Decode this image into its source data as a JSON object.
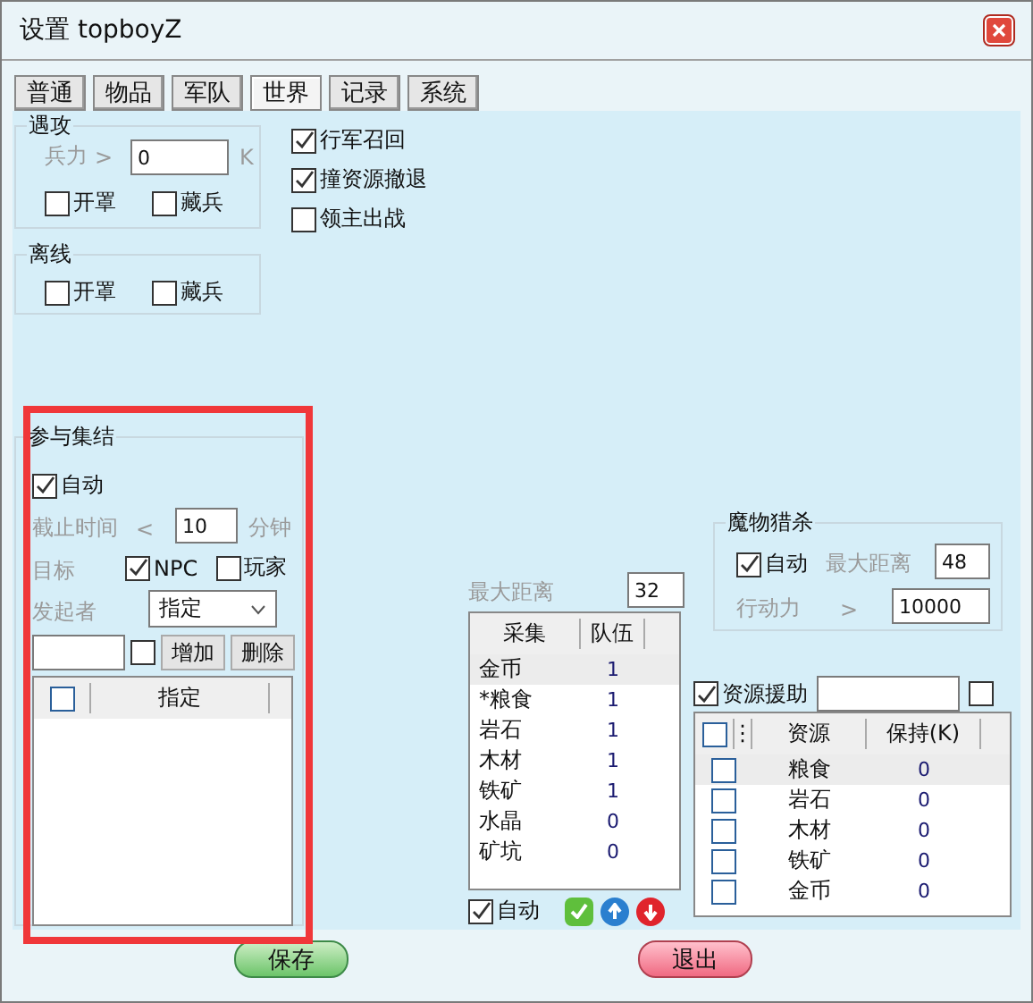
{
  "window": {
    "title": "设置 topboyZ"
  },
  "tabs": [
    {
      "label": "普通",
      "selected": false
    },
    {
      "label": "物品",
      "selected": false
    },
    {
      "label": "军队",
      "selected": false
    },
    {
      "label": "世界",
      "selected": true
    },
    {
      "label": "记录",
      "selected": false
    },
    {
      "label": "系统",
      "selected": false
    }
  ],
  "encounter": {
    "title": "遇攻",
    "strength_label": "兵力",
    "strength_op": ">",
    "strength_value": "0",
    "strength_unit": "K",
    "options": [
      {
        "label": "开罩",
        "checked": false
      },
      {
        "label": "藏兵",
        "checked": false
      }
    ]
  },
  "offline": {
    "title": "离线",
    "options": [
      {
        "label": "开罩",
        "checked": false
      },
      {
        "label": "藏兵",
        "checked": false
      }
    ]
  },
  "march_options": [
    {
      "label": "行军召回",
      "checked": true
    },
    {
      "label": "撞资源撤退",
      "checked": true
    },
    {
      "label": "领主出战",
      "checked": false
    }
  ],
  "rally": {
    "title": "参与集结",
    "auto": {
      "label": "自动",
      "checked": true
    },
    "deadline_label": "截止时间",
    "deadline_op": "<",
    "deadline_value": "10",
    "deadline_unit": "分钟",
    "target_label": "目标",
    "targets": [
      {
        "label": "NPC",
        "checked": true
      },
      {
        "label": "玩家",
        "checked": false
      }
    ],
    "initiator_label": "发起者",
    "initiator_value": "指定",
    "name_checked": false,
    "add_button": "增加",
    "delete_button": "删除",
    "table": {
      "header_checked": false,
      "column": "指定"
    }
  },
  "gather": {
    "distance_label": "最大距离",
    "distance_value": "32",
    "columns": [
      "采集",
      "队伍"
    ],
    "rows": [
      {
        "name": "金币",
        "count": "1",
        "selected": true
      },
      {
        "name": "*粮食",
        "count": "1",
        "selected": false
      },
      {
        "name": "岩石",
        "count": "1",
        "selected": false
      },
      {
        "name": "木材",
        "count": "1",
        "selected": false
      },
      {
        "name": "铁矿",
        "count": "1",
        "selected": false
      },
      {
        "name": "水晶",
        "count": "0",
        "selected": false
      },
      {
        "name": "矿坑",
        "count": "0",
        "selected": false
      }
    ],
    "auto": {
      "label": "自动",
      "checked": true
    }
  },
  "monster": {
    "title": "魔物猎杀",
    "auto": {
      "label": "自动",
      "checked": true
    },
    "distance_label": "最大距离",
    "distance_value": "48",
    "stamina_label": "行动力",
    "stamina_op": ">",
    "stamina_value": "10000"
  },
  "resource_aid": {
    "label": "资源援助",
    "checked": true,
    "extra_checked": false,
    "columns": [
      "⋮",
      "资源",
      "保持(K)"
    ],
    "header_checked": false,
    "rows": [
      {
        "name": "粮食",
        "value": "0",
        "checked": false,
        "selected": true
      },
      {
        "name": "岩石",
        "value": "0",
        "checked": false,
        "selected": false
      },
      {
        "name": "木材",
        "value": "0",
        "checked": false,
        "selected": false
      },
      {
        "name": "铁矿",
        "value": "0",
        "checked": false,
        "selected": false
      },
      {
        "name": "金币",
        "value": "0",
        "checked": false,
        "selected": false
      }
    ]
  },
  "buttons": {
    "save": "保存",
    "exit": "退出"
  }
}
